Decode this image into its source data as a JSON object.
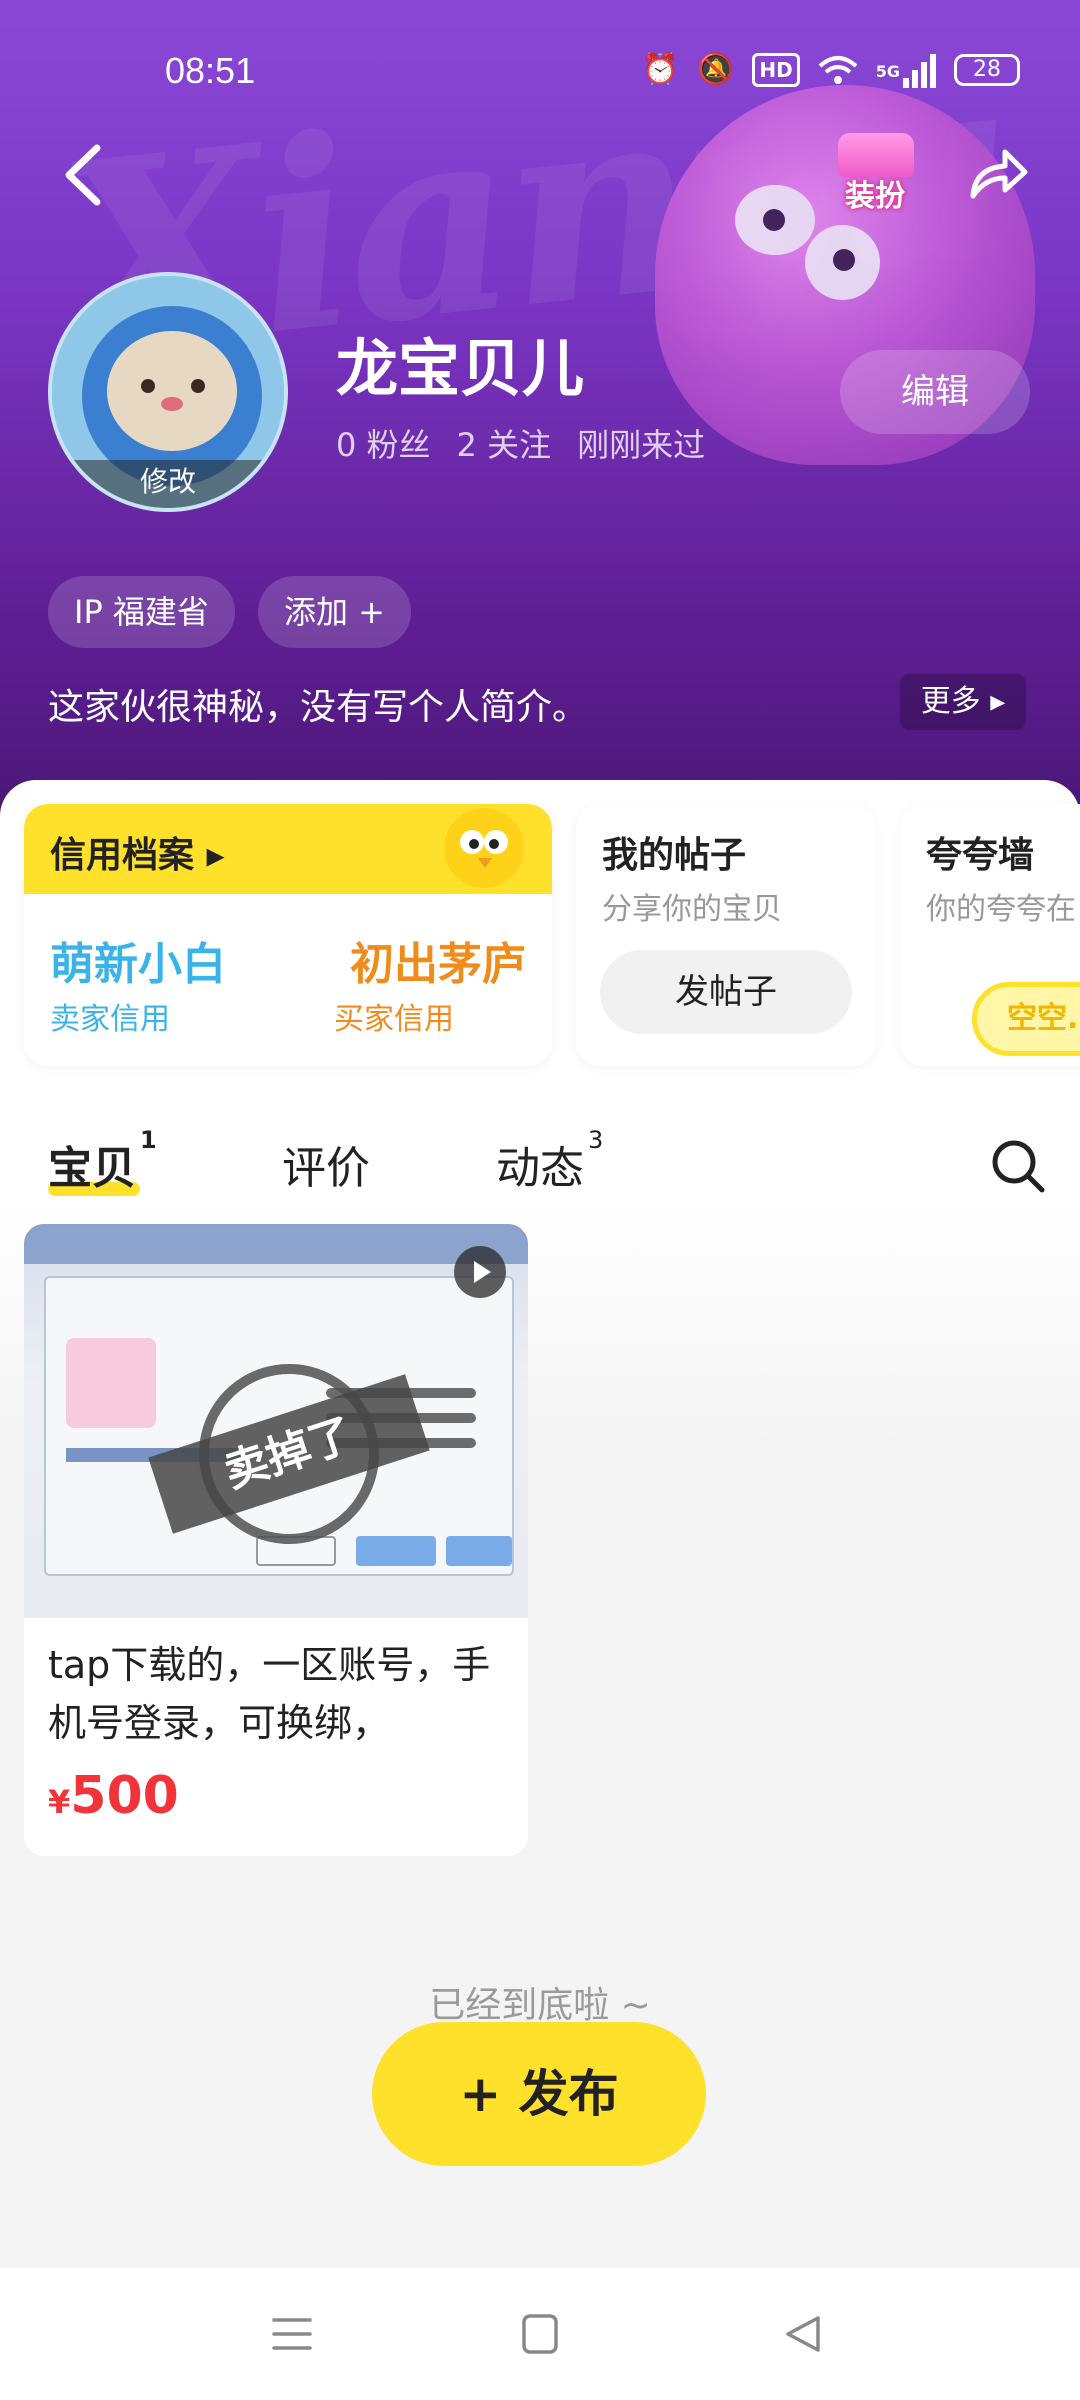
{
  "status_bar": {
    "time": "08:51",
    "hd_label": "HD",
    "network_label": "5G",
    "battery": "28"
  },
  "header": {
    "watermark_text": "Xianyu",
    "dress_up_label": "装扮",
    "avatar_edit_label": "修改",
    "username": "龙宝贝儿",
    "stats": {
      "followers": "0 粉丝",
      "following": "2 关注",
      "last_seen": "刚刚来过"
    },
    "edit_label": "编辑",
    "chips": [
      "IP 福建省",
      "添加 +"
    ],
    "bio": "这家伙很神秘，没有写个人简介。",
    "more_label": "更多 ▸"
  },
  "cards": {
    "credit": {
      "title": "信用档案 ▸",
      "seller_value": "萌新小白",
      "seller_label": "卖家信用",
      "buyer_value": "初出茅庐",
      "buyer_label": "买家信用"
    },
    "posts": {
      "title": "我的帖子",
      "subtitle": "分享你的宝贝",
      "button": "发帖子"
    },
    "praise": {
      "title": "夸夸墙",
      "subtitle": "你的夸夸在",
      "bubble": "空空..."
    }
  },
  "tabs": [
    {
      "label": "宝贝",
      "count": "1"
    },
    {
      "label": "评价",
      "count": ""
    },
    {
      "label": "动态",
      "count": "3"
    }
  ],
  "items": [
    {
      "stamp_text": "卖掉了",
      "description": "tap下载的，一区账号，手机号登录，可换绑，",
      "currency": "¥",
      "price": "500"
    }
  ],
  "end_tip": "已经到底啦 ~",
  "publish_label": "+ 发布",
  "colors": {
    "accent_yellow": "#ffe12b",
    "header_purple": "#7a36c4",
    "price_red": "#f2333a",
    "seller_blue": "#3ab3e8",
    "buyer_orange": "#f08c1c"
  }
}
